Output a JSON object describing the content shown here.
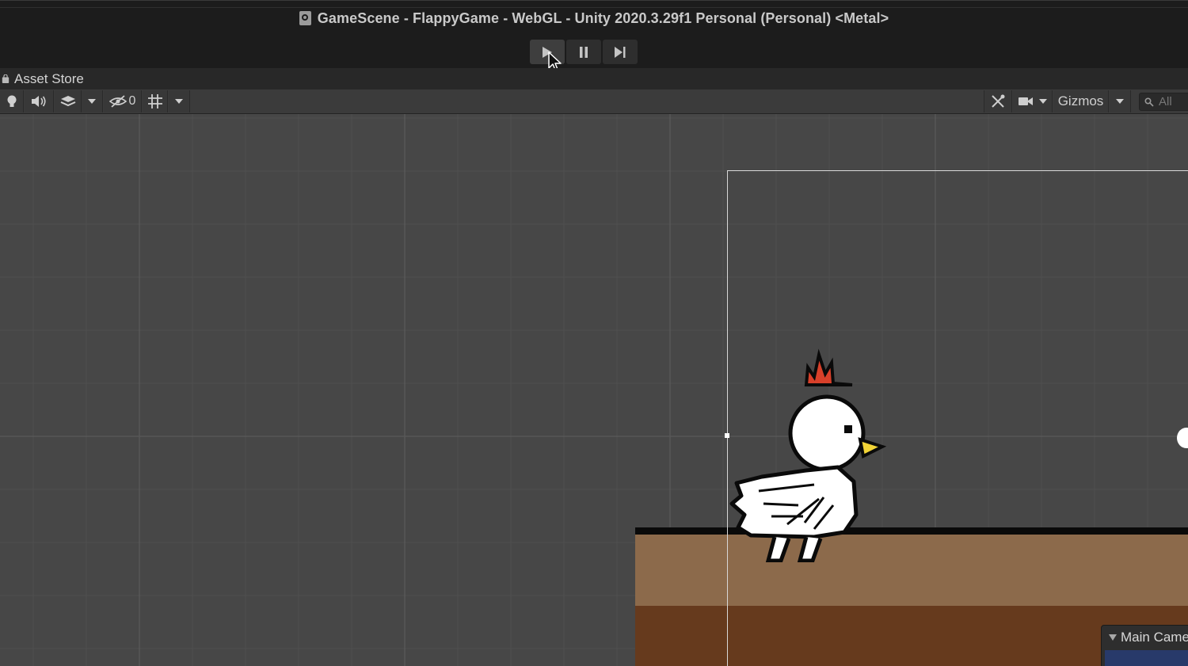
{
  "window": {
    "title": "GameScene - FlappyGame - WebGL - Unity 2020.3.29f1 Personal (Personal) <Metal>"
  },
  "playbar": {
    "buttons": [
      {
        "name": "play",
        "icon": "play-icon"
      },
      {
        "name": "pause",
        "icon": "pause-icon"
      },
      {
        "name": "step",
        "icon": "step-icon"
      }
    ]
  },
  "tab": {
    "label": "Asset Store"
  },
  "scene_toolbar": {
    "hidden_count": "0",
    "gizmos_label": "Gizmos",
    "search_placeholder": "All"
  },
  "scene": {
    "camera_panel_label": "Main Came",
    "colors": {
      "background": "#474747",
      "ground_light": "#8c6a4b",
      "ground_dark": "#663a1d",
      "crest": "#d8402a",
      "beak": "#f2d437"
    }
  }
}
